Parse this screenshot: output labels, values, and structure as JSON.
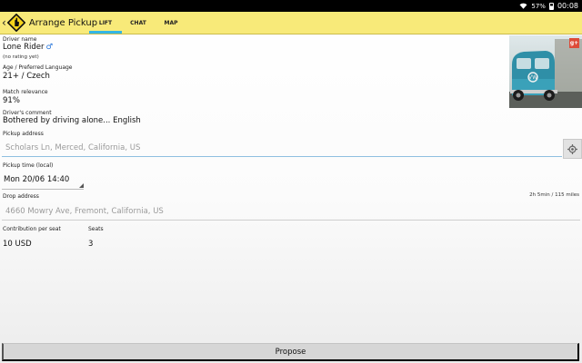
{
  "status_bar": {
    "battery": "57%",
    "time": "00:08",
    "wifi_icon": "wifi-icon",
    "battery_icon": "battery-icon"
  },
  "action_bar": {
    "title": "Arrange Pickup",
    "back_icon": "chevron-left-icon",
    "logo_icon": "thumb-sign-icon",
    "tabs": [
      {
        "label": "LIFT",
        "active": true
      },
      {
        "label": "CHAT",
        "active": false
      },
      {
        "label": "MAP",
        "active": false
      }
    ],
    "accent_color": "#33b5e5",
    "background_color": "#f8ea79"
  },
  "driver": {
    "name_label": "Driver name",
    "name": "Lone Rider",
    "gender_symbol": "♂",
    "rating": "(no rating yet)",
    "age_language_label": "Age / Preferred Language",
    "age_language": "21+ / Czech",
    "match_label": "Match relevance",
    "match": "91%",
    "comment_label": "Driver's comment",
    "comment": "Bothered by driving alone... English",
    "badge": "g+"
  },
  "pickup": {
    "address_label": "Pickup address",
    "address_placeholder": "Scholars Ln, Merced, California, US",
    "time_label": "Pickup time (local)",
    "time_value": "Mon 20/06 14:40",
    "locate_icon": "locate-icon"
  },
  "drop": {
    "address_label": "Drop address",
    "address_placeholder": "4660 Mowry Ave, Fremont, California, US",
    "eta": "2h 5min / 115 miles"
  },
  "booking": {
    "contribution_label": "Contribution per seat",
    "contribution": "10 USD",
    "seats_label": "Seats",
    "seats": "3"
  },
  "propose_label": "Propose"
}
